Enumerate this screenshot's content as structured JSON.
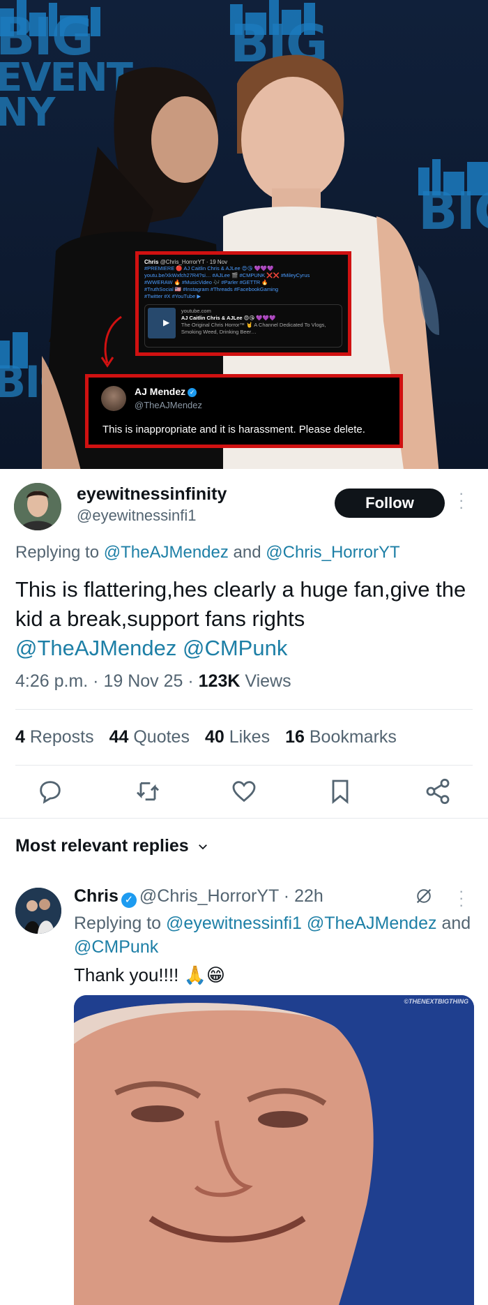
{
  "media": {
    "backdrop_logo": [
      "BIG",
      "EVENT",
      "NY"
    ],
    "embedded_tweet": {
      "author": "Chris",
      "meta": "@Chris_HorrorYT · 19 Nov",
      "lines": [
        "#PREMIERE 🔴 AJ Caitlin Chris & AJLee 😍😘 💜💜💜",
        "youtu.be/XkWxfch27R4?si… #AJLee 🎬 #CMPUNK ❌❌ #MileyCyrus",
        "#WWERAW 🔥 #MusicVideo 🎶 #Parler #GETTR 🔥",
        "#TruthSocial 🇺🇸 #Instagram #Threads #FacebookGaming",
        "#Twitter #X #YouTube ▶"
      ],
      "link_domain": "youtube.com",
      "link_title": "AJ Caitlin Chris & AJLee 😍😘 💜💜💜",
      "link_desc": "The Original Chris Horror™ 🤘 A Channel Dedicated To Vlogs, Smoking Weed, Drinking Beer…"
    },
    "reply_card": {
      "name": "AJ Mendez",
      "handle": "@TheAJMendez",
      "text": "This is inappropriate and it is harassment. Please delete."
    }
  },
  "tweet": {
    "display_name": "eyewitnessinfinity",
    "handle": "@eyewitnessinfi1",
    "follow_label": "Follow",
    "replying_prefix": "Replying to",
    "replying_user1": "@TheAJMendez",
    "replying_and": "and",
    "replying_user2": "@Chris_HorrorYT",
    "text": "This is flattering,hes clearly a huge fan,give the kid a break,support fans rights",
    "mention1": "@TheAJMendez",
    "mention2": "@CMPunk",
    "time": "4:26 p.m.",
    "date": "19 Nov 25",
    "views_count": "123K",
    "views_label": "Views",
    "stats": [
      {
        "count": "4",
        "label": "Reposts"
      },
      {
        "count": "44",
        "label": "Quotes"
      },
      {
        "count": "40",
        "label": "Likes"
      },
      {
        "count": "16",
        "label": "Bookmarks"
      }
    ],
    "action_icons": [
      "reply-icon",
      "repost-icon",
      "like-icon",
      "bookmark-icon",
      "share-icon"
    ]
  },
  "replies_header": "Most relevant replies",
  "reply": {
    "name": "Chris",
    "handle": "@Chris_HorrorYT",
    "age": "22h",
    "replying_prefix": "Replying to",
    "replying_user1": "@eyewitnessinfi1",
    "replying_user2": "@TheAJMendez",
    "replying_and": "and",
    "replying_user3": "@CMPunk",
    "text": "Thank you!!!! 🙏😁",
    "media_watermark": "©THENEXTBIGTHING"
  },
  "colors": {
    "link": "#1d7fa6",
    "verified": "#1d9bf0",
    "highlight_border": "#d01111",
    "follow_bg": "#0f1419"
  }
}
